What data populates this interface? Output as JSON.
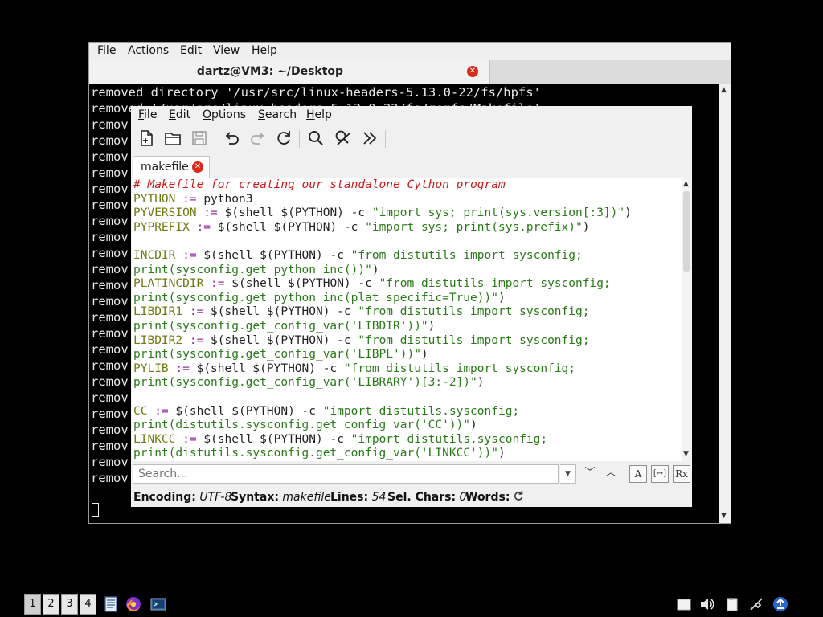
{
  "terminal": {
    "menu": [
      "File",
      "Actions",
      "Edit",
      "View",
      "Help"
    ],
    "tab_title": "dartz@VM3: ~/Desktop",
    "lines": [
      "removed directory '/usr/src/linux-headers-5.13.0-22/fs/hpfs'",
      "removed '/usr/src/linux-headers-5.13.0-22/fs/romfs/Makefile'",
      "remov",
      "remov",
      "remov",
      "remov",
      "remov",
      "remov",
      "remov",
      "remov",
      "remov",
      "remov",
      "remov",
      "remov",
      "remov",
      "remov",
      "remov",
      "remov",
      "remov",
      "remov",
      "remov",
      "remov",
      "remov",
      "remov",
      "remov"
    ]
  },
  "editor": {
    "menu": {
      "file": {
        "u": "F",
        "rest": "ile"
      },
      "edit": {
        "u": "E",
        "rest": "dit"
      },
      "options": {
        "u": "O",
        "rest": "ptions"
      },
      "search": {
        "u": "S",
        "rest": "earch"
      },
      "help": {
        "u": "H",
        "rest": "elp"
      }
    },
    "toolbar_icons": [
      "new-document-icon",
      "open-folder-icon",
      "save-icon",
      "undo-icon",
      "redo-icon",
      "reload-icon",
      "find-icon",
      "find-replace-icon",
      "go-to-line-icon"
    ],
    "tab_label": "makefile",
    "code": [
      [
        {
          "t": "c",
          "x": "# Makefile for creating our standalone Cython program"
        }
      ],
      [
        {
          "t": "v",
          "x": "PYTHON"
        },
        {
          "t": "o",
          "x": " :="
        },
        {
          "t": "p",
          "x": " python3"
        }
      ],
      [
        {
          "t": "v",
          "x": "PYVERSION"
        },
        {
          "t": "o",
          "x": " :="
        },
        {
          "t": "p",
          "x": " $(shell $(PYTHON) -c "
        },
        {
          "t": "s",
          "x": "\"import sys; print(sys.version[:3])\""
        },
        {
          "t": "p",
          "x": ")"
        }
      ],
      [
        {
          "t": "v",
          "x": "PYPREFIX"
        },
        {
          "t": "o",
          "x": " :="
        },
        {
          "t": "p",
          "x": " $(shell $(PYTHON) -c "
        },
        {
          "t": "s",
          "x": "\"import sys; print(sys.prefix)\""
        },
        {
          "t": "p",
          "x": ")"
        }
      ],
      [
        {
          "t": "p",
          "x": ""
        }
      ],
      [
        {
          "t": "v",
          "x": "INCDIR"
        },
        {
          "t": "o",
          "x": " :="
        },
        {
          "t": "p",
          "x": " $(shell $(PYTHON) -c "
        },
        {
          "t": "s",
          "x": "\"from distutils import sysconfig;"
        }
      ],
      [
        {
          "t": "s",
          "x": "print(sysconfig.get_python_inc())\""
        },
        {
          "t": "p",
          "x": ")"
        }
      ],
      [
        {
          "t": "v",
          "x": "PLATINCDIR"
        },
        {
          "t": "o",
          "x": " :="
        },
        {
          "t": "p",
          "x": " $(shell $(PYTHON) -c "
        },
        {
          "t": "s",
          "x": "\"from distutils import sysconfig;"
        }
      ],
      [
        {
          "t": "s",
          "x": "print(sysconfig.get_python_inc(plat_specific=True))\""
        },
        {
          "t": "p",
          "x": ")"
        }
      ],
      [
        {
          "t": "v",
          "x": "LIBDIR1"
        },
        {
          "t": "o",
          "x": " :="
        },
        {
          "t": "p",
          "x": " $(shell $(PYTHON) -c "
        },
        {
          "t": "s",
          "x": "\"from distutils import sysconfig;"
        }
      ],
      [
        {
          "t": "s",
          "x": "print(sysconfig.get_config_var('LIBDIR'))\""
        },
        {
          "t": "p",
          "x": ")"
        }
      ],
      [
        {
          "t": "v",
          "x": "LIBDIR2"
        },
        {
          "t": "o",
          "x": " :="
        },
        {
          "t": "p",
          "x": " $(shell $(PYTHON) -c "
        },
        {
          "t": "s",
          "x": "\"from distutils import sysconfig;"
        }
      ],
      [
        {
          "t": "s",
          "x": "print(sysconfig.get_config_var('LIBPL'))\""
        },
        {
          "t": "p",
          "x": ")"
        }
      ],
      [
        {
          "t": "v",
          "x": "PYLIB"
        },
        {
          "t": "o",
          "x": " :="
        },
        {
          "t": "p",
          "x": " $(shell $(PYTHON) -c "
        },
        {
          "t": "s",
          "x": "\"from distutils import sysconfig;"
        }
      ],
      [
        {
          "t": "s",
          "x": "print(sysconfig.get_config_var('LIBRARY')[3:-2])\""
        },
        {
          "t": "p",
          "x": ")"
        }
      ],
      [
        {
          "t": "p",
          "x": ""
        }
      ],
      [
        {
          "t": "v",
          "x": "CC"
        },
        {
          "t": "o",
          "x": " :="
        },
        {
          "t": "p",
          "x": " $(shell $(PYTHON) -c "
        },
        {
          "t": "s",
          "x": "\"import distutils.sysconfig;"
        }
      ],
      [
        {
          "t": "s",
          "x": "print(distutils.sysconfig.get_config_var('CC'))\""
        },
        {
          "t": "p",
          "x": ")"
        }
      ],
      [
        {
          "t": "v",
          "x": "LINKCC"
        },
        {
          "t": "o",
          "x": " :="
        },
        {
          "t": "p",
          "x": " $(shell $(PYTHON) -c "
        },
        {
          "t": "s",
          "x": "\"import distutils.sysconfig;"
        }
      ],
      [
        {
          "t": "s",
          "x": "print(distutils.sysconfig.get_config_var('LINKCC'))\""
        },
        {
          "t": "p",
          "x": ")"
        }
      ]
    ],
    "search": {
      "placeholder": "Search...",
      "toggles": [
        "A",
        "[↔]",
        "Rx"
      ]
    },
    "status": {
      "encoding_label": "Encoding:",
      "encoding_value": "UTF-8",
      "syntax_label": "Syntax:",
      "syntax_value": "makefile",
      "lines_label": "Lines:",
      "lines_value": "54",
      "sel_label": "Sel. Chars:",
      "sel_value": "0",
      "words_label": "Words:"
    }
  },
  "taskbar": {
    "workspaces": [
      "1",
      "2",
      "3",
      "4"
    ],
    "active_workspace": "1",
    "launchers": [
      "file-manager-icon",
      "firefox-icon",
      "terminal-icon"
    ],
    "tray": [
      "clipboard-icon",
      "volume-icon",
      "notes-icon",
      "network-icon",
      "update-icon"
    ]
  },
  "colors": {
    "comment": "#cc1a1a",
    "variable": "#6e7a12",
    "operator": "#9a2fa0",
    "string": "#2a7a1a",
    "close": "#d92a1c"
  }
}
